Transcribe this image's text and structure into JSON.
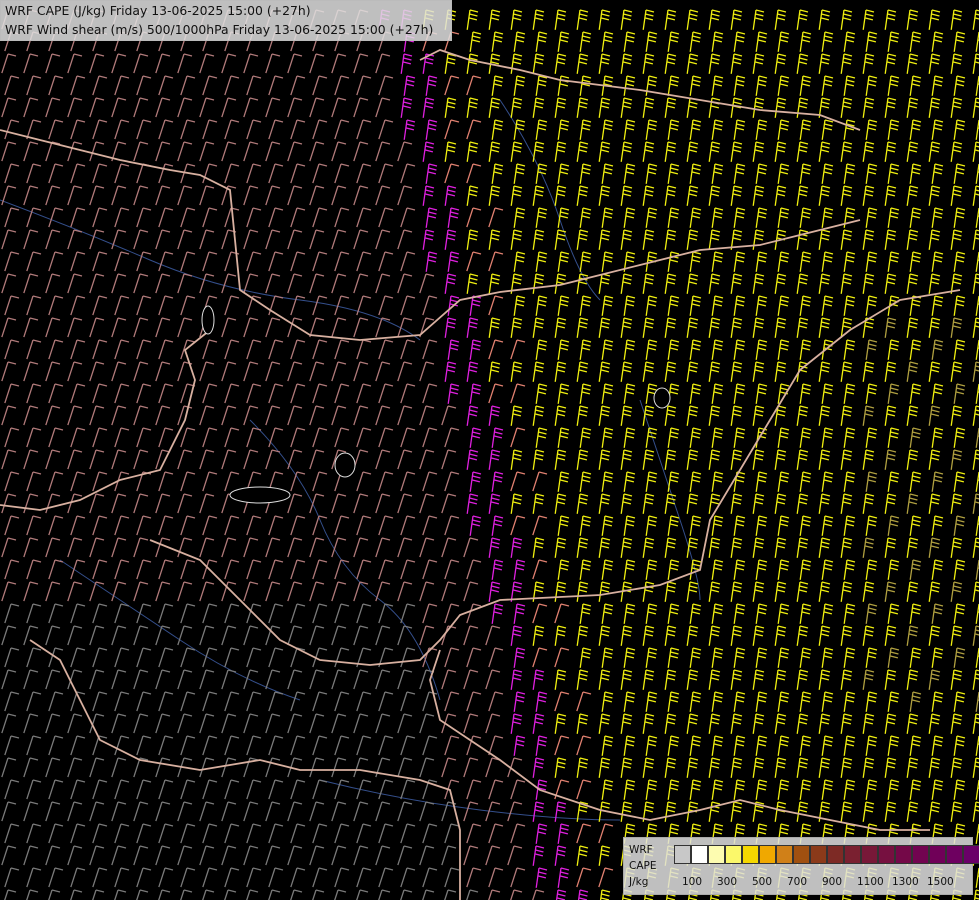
{
  "title": {
    "line1": "WRF CAPE (J/kg) Friday 13-06-2025 15:00 (+27h)",
    "line2": "WRF Wind shear (m/s) 500/1000hPa Friday 13-06-2025 15:00 (+27h)"
  },
  "legend": {
    "label1": "WRF",
    "label2": "CAPE",
    "label3": "J/kg",
    "colors": [
      "#c8c8c8",
      "#ffffff",
      "#fdfcb0",
      "#fbf86a",
      "#f5d800",
      "#f0a800",
      "#d08018",
      "#a05010",
      "#8b3a1a",
      "#7d2a25",
      "#7a2030",
      "#781838",
      "#761040",
      "#740848",
      "#720450",
      "#700058",
      "#6e0060",
      "#6a0068"
    ],
    "ticks": [
      "100",
      "300",
      "500",
      "700",
      "900",
      "1100",
      "1300",
      "1500"
    ]
  },
  "map": {
    "barb_colors": {
      "low": "#7a7a7a",
      "pinkish": "#b07a7a",
      "salmon": "#e08070",
      "magenta": "#e020e0",
      "yellow": "#f0f010",
      "olive": "#b0a040"
    },
    "border_color": "#d8b0a0",
    "river_color": "#4a70c8"
  }
}
